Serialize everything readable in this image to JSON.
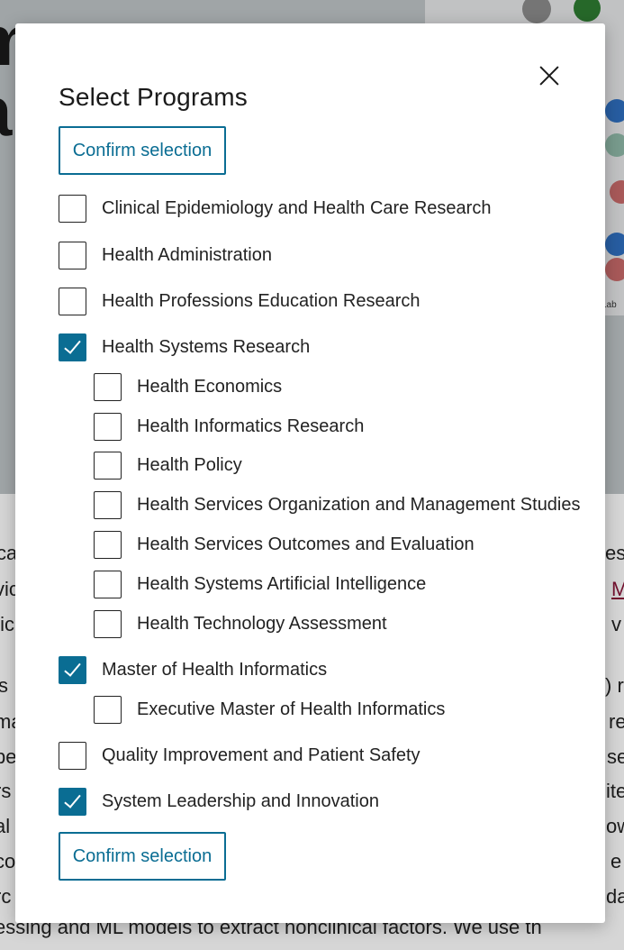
{
  "modal": {
    "title": "Select Programs",
    "confirm_label": "Confirm selection",
    "options": [
      {
        "label": "Clinical Epidemiology and Health Care Research",
        "checked": false,
        "level": 0
      },
      {
        "label": "Health Administration",
        "checked": false,
        "level": 0
      },
      {
        "label": "Health Professions Education Research",
        "checked": false,
        "level": 0
      },
      {
        "label": "Health Systems Research",
        "checked": true,
        "level": 0
      },
      {
        "label": "Health Economics",
        "checked": false,
        "level": 1
      },
      {
        "label": "Health Informatics Research",
        "checked": false,
        "level": 1
      },
      {
        "label": "Health Policy",
        "checked": false,
        "level": 1
      },
      {
        "label": "Health Services Organization and Management Studies",
        "checked": false,
        "level": 1
      },
      {
        "label": "Health Services Outcomes and Evaluation",
        "checked": false,
        "level": 1
      },
      {
        "label": "Health Systems Artificial Intelligence",
        "checked": false,
        "level": 1
      },
      {
        "label": "Health Technology Assessment",
        "checked": false,
        "level": 1
      },
      {
        "label": "Master of Health Informatics",
        "checked": true,
        "level": 0
      },
      {
        "label": "Executive Master of Health Informatics",
        "checked": false,
        "level": 1
      },
      {
        "label": "Quality Improvement and Patient Safety",
        "checked": false,
        "level": 0
      },
      {
        "label": "System Leadership and Innovation",
        "checked": true,
        "level": 0
      }
    ]
  },
  "background": {
    "hero_lines": [
      "m",
      "a"
    ],
    "map_label": "Lab",
    "lines": [
      "ca",
      "vic",
      "tic",
      "s",
      "ma",
      "pe",
      "rs",
      "al",
      "co",
      "rc"
    ],
    "right_fragments": [
      "es",
      "M",
      "v",
      ") r",
      "re",
      "se",
      "ite",
      "ow",
      "e",
      "dat"
    ],
    "link_fragment": "M",
    "last_line": "essing and ML models to extract nonclinical factors. We use th"
  },
  "colors": {
    "accent": "#0a6d93"
  }
}
